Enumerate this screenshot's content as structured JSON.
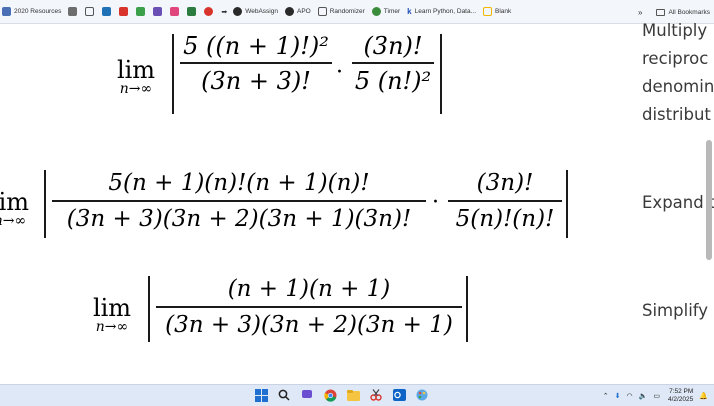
{
  "bookmarks": {
    "items": [
      {
        "label": "2020 Resources",
        "color": "#4a6fb5"
      },
      {
        "label": "",
        "color": "#6d6d6d"
      },
      {
        "label": "",
        "color": "#1f72b6"
      },
      {
        "label": "",
        "color": "#d9342b"
      },
      {
        "label": "",
        "color": "#3aa14a"
      },
      {
        "label": "",
        "color": "#6a4fb5"
      },
      {
        "label": "",
        "color": "#e0467b"
      },
      {
        "label": "",
        "color": "#2c7c3f"
      },
      {
        "label": "",
        "color": "#d9342b"
      },
      {
        "label": "WebAssign",
        "color": "#2a2a2a"
      },
      {
        "label": "APO",
        "color": "#2a2a2a"
      },
      {
        "label": "Randomizer",
        "color": "#555555"
      },
      {
        "label": "Timer",
        "color": "#3b8d3b"
      },
      {
        "label": "Learn Python, Data...",
        "color": "#1d4fb8"
      },
      {
        "label": "Blank",
        "color": "#f2b800"
      }
    ],
    "more": "»",
    "all_bookmarks": "All Bookmarks"
  },
  "math": {
    "lim_word": "lim",
    "lim_sub": "n→∞",
    "row1": {
      "f1_num": "5 ((n + 1)!)²",
      "f1_den": "(3n + 3)!",
      "f2_num": "(3n)!",
      "f2_den": "5 (n!)²"
    },
    "row2": {
      "f1_num": "5(n + 1)(n)!(n + 1)(n)!",
      "f1_den": "(3n + 3)(3n + 2)(3n + 1)(3n)!",
      "f2_num": "(3n)!",
      "f2_den": "5(n)!(n)!"
    },
    "row3": {
      "f1_num": "(n + 1)(n + 1)",
      "f1_den": "(3n + 3)(3n + 2)(3n + 1)"
    },
    "cdot": "·"
  },
  "notes": {
    "n1": "Multiply",
    "n2": "reciproc",
    "n3": "denomin",
    "n4": "distribut",
    "n5": "Expand t",
    "n6": "Simplify"
  },
  "taskbar": {
    "time": "7:52 PM",
    "date": "4/2/2025"
  }
}
